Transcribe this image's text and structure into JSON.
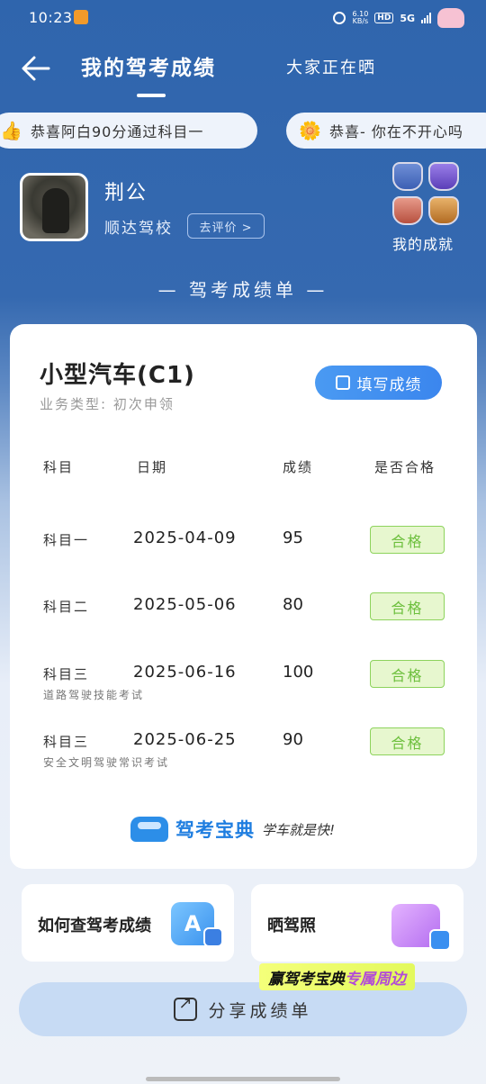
{
  "status_bar": {
    "time": "10:23",
    "net_speed_value": "6.10",
    "net_speed_unit": "KB/s",
    "hd": "HD",
    "network": "5G"
  },
  "header": {
    "title": "我的驾考成绩",
    "tab2": "大家正在晒"
  },
  "marquee": [
    {
      "text": "恭喜阿白90分通过科目一",
      "icon": "thumbs-up-icon"
    },
    {
      "text": "恭喜- 你在不开心吗",
      "icon": "flower-icon"
    }
  ],
  "profile": {
    "name": "荆公",
    "school": "顺达驾校",
    "rate_button": "去评价 >",
    "achievements_label": "我的成就"
  },
  "section_title": "— 驾考成绩单 —",
  "card": {
    "vehicle": "小型汽车(C1)",
    "business": "业务类型: 初次申领",
    "fill_button": "填写成绩",
    "headers": {
      "subject": "科目",
      "date": "日期",
      "score": "成绩",
      "pass": "是否合格"
    },
    "rows": [
      {
        "subject": "科目一",
        "date": "2025-04-09",
        "score": "95",
        "result": "合格",
        "note": ""
      },
      {
        "subject": "科目二",
        "date": "2025-05-06",
        "score": "80",
        "result": "合格",
        "note": ""
      },
      {
        "subject": "科目三",
        "date": "2025-06-16",
        "score": "100",
        "result": "合格",
        "note": "道路驾驶技能考试"
      },
      {
        "subject": "科目三",
        "date": "2025-06-25",
        "score": "90",
        "result": "合格",
        "note": "安全文明驾驶常识考试"
      }
    ],
    "brand_name": "驾考宝典",
    "brand_slogan": "学车就是快!"
  },
  "links": {
    "query": "如何查驾考成绩",
    "license": "晒驾照"
  },
  "promo": {
    "part1": "赢驾考宝典",
    "part2": "专属周边"
  },
  "share_button": "分享成绩单",
  "colors": {
    "header_bg": "#2f65ad",
    "primary_button": "#3b86ee",
    "pass_bg": "#e7f7cf",
    "pass_text": "#6cbf3c"
  }
}
